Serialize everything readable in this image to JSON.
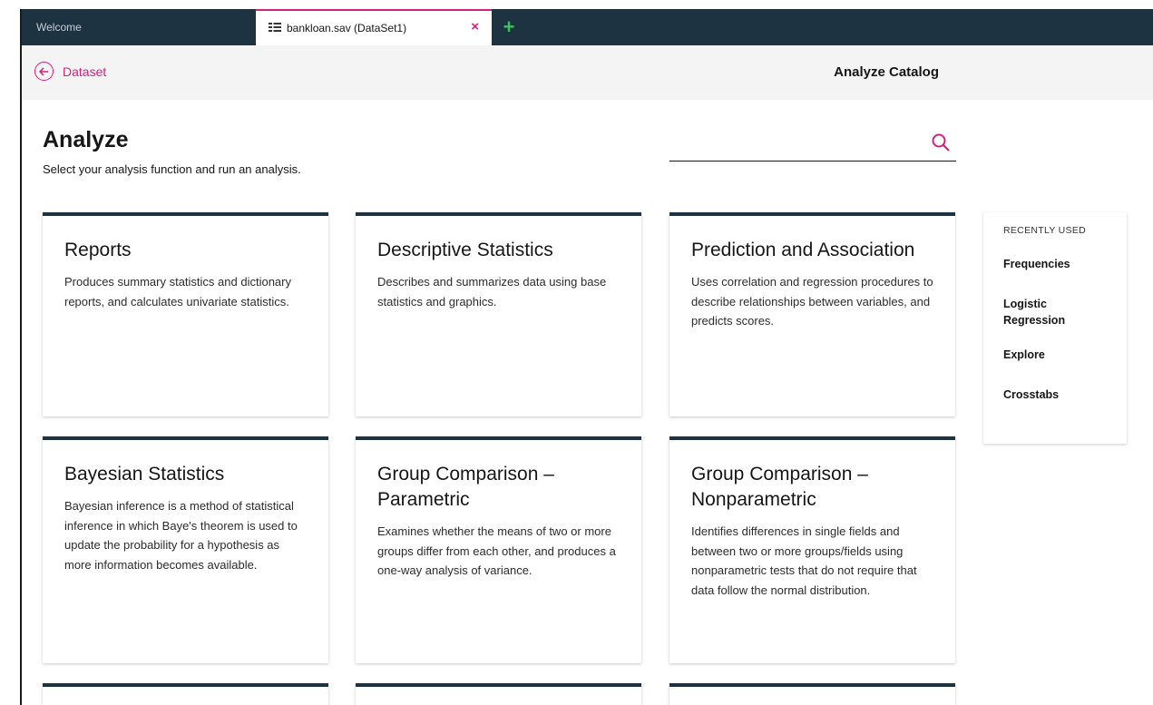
{
  "tabs": {
    "welcome_label": "Welcome",
    "active_label": "bankloan.sav (DataSet1)",
    "active_close": "×",
    "add_label": "+"
  },
  "header": {
    "back_label": "Dataset",
    "title": "Analyze Catalog"
  },
  "page": {
    "title": "Analyze",
    "subtitle": "Select your analysis function and run an analysis."
  },
  "search": {
    "value": "",
    "placeholder": ""
  },
  "cards": [
    {
      "title": "Reports",
      "description": "Produces summary statistics and dictionary reports, and calculates univariate statistics."
    },
    {
      "title": "Descriptive Statistics",
      "description": "Describes and summarizes data using base statistics and graphics."
    },
    {
      "title": "Prediction and Association",
      "description": "Uses correlation and regression procedures to describe relationships between variables, and predicts scores."
    },
    {
      "title": "Bayesian Statistics",
      "description": "Bayesian inference is a method of statistical inference in which Baye's theorem is used to update the probability for a hypothesis as more information becomes available."
    },
    {
      "title": "Group Comparison – Parametric",
      "description": "Examines whether the means of two or more groups differ from each other, and produces a one-way analysis of variance."
    },
    {
      "title": "Group Comparison – Nonparametric",
      "description": "Identifies differences in single fields and between two or more groups/fields using nonparametric tests that do not require that data follow the normal distribution."
    }
  ],
  "recently_used": {
    "heading": "RECENTLY USED",
    "items": [
      "Frequencies",
      "Logistic Regression",
      "Explore",
      "Crosstabs"
    ]
  },
  "colors": {
    "accent": "#d2237a",
    "tabbar": "#1d3342",
    "card_border": "#1d3342",
    "add_tab": "#42be65"
  }
}
